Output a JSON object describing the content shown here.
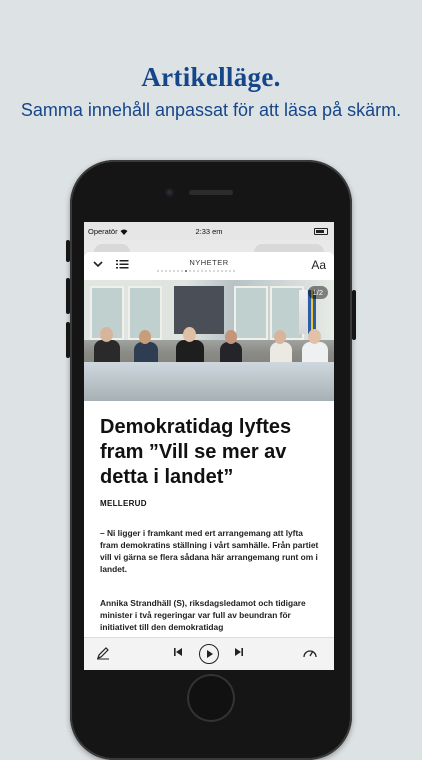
{
  "promo": {
    "title": "Artikelläge.",
    "subtitle": "Samma innehåll anpassat för att läsa på skärm."
  },
  "status": {
    "carrier": "Operatör",
    "time": "2:33 em"
  },
  "article_header": {
    "section": "NYHETER",
    "textsize_label": "Aa",
    "page_dots": 20,
    "active_dot": 7
  },
  "image": {
    "counter": "1/2"
  },
  "article": {
    "headline": "Demokratidag lyftes fram ”Vill se mer av detta i landet”",
    "location": "MELLERUD",
    "paragraphs": [
      "– Ni ligger i framkant med ert arrangemang att lyfta fram demokratins ställning i vårt samhälle. Från partiet vill vi gärna se flera sådana här arrangemang runt om i landet.",
      "Annika Strandhäll (S), riksdagsledamot och tidigare minister i två regeringar var full av beundran för initiativet till den demokratidag"
    ]
  },
  "icons": {
    "close": "chevron-down-icon",
    "menu": "list-icon",
    "highlight": "pen-icon",
    "prev": "skip-back-icon",
    "play": "play-icon",
    "next": "skip-forward-icon",
    "speed": "gauge-icon"
  },
  "colors": {
    "brand": "#16468a",
    "background": "#dde3e5"
  }
}
